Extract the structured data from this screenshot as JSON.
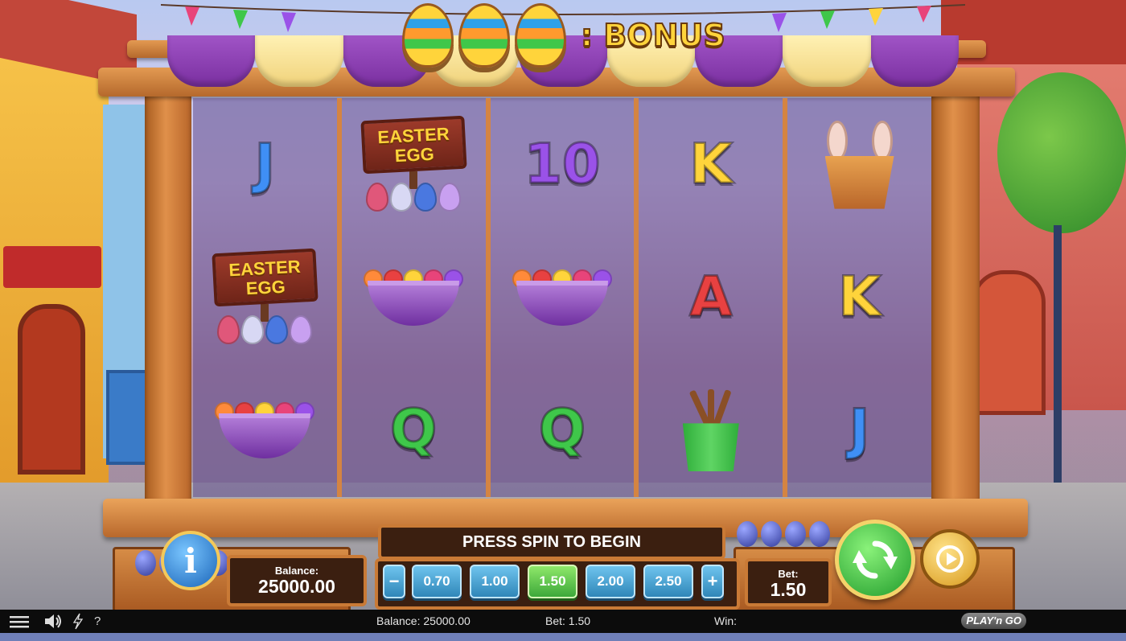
{
  "bonus": {
    "label": ": BONUS",
    "egg_count": 3
  },
  "reels": [
    [
      "J",
      "easter-egg-sign",
      "candy-bowl"
    ],
    [
      "easter-egg-sign",
      "candy-bowl",
      "Q"
    ],
    [
      "10",
      "candy-bowl",
      "Q"
    ],
    [
      "K",
      "A",
      "paint-bucket"
    ],
    [
      "bunny-pot",
      "K",
      "J"
    ]
  ],
  "symbols": {
    "easter_egg_sign": "EASTER\nEGG"
  },
  "message": "PRESS SPIN TO BEGIN",
  "balance_panel": {
    "label": "Balance:",
    "value": "25000.00"
  },
  "bet_panel": {
    "label": "Bet:",
    "value": "1.50"
  },
  "bet_controls": {
    "minus": "−",
    "plus": "+",
    "options": [
      "0.70",
      "1.00",
      "1.50",
      "2.00",
      "2.50"
    ],
    "selected": "1.50"
  },
  "info_button": "i",
  "status_bar": {
    "balance": "Balance: 25000.00",
    "bet": "Bet: 1.50",
    "win": "Win:",
    "help": "?",
    "logo": "PLAY'n GO"
  },
  "colors": {
    "frame_wood": "#d48442",
    "spin_green": "#3fc74a",
    "text_yellow": "#ffd43b"
  }
}
